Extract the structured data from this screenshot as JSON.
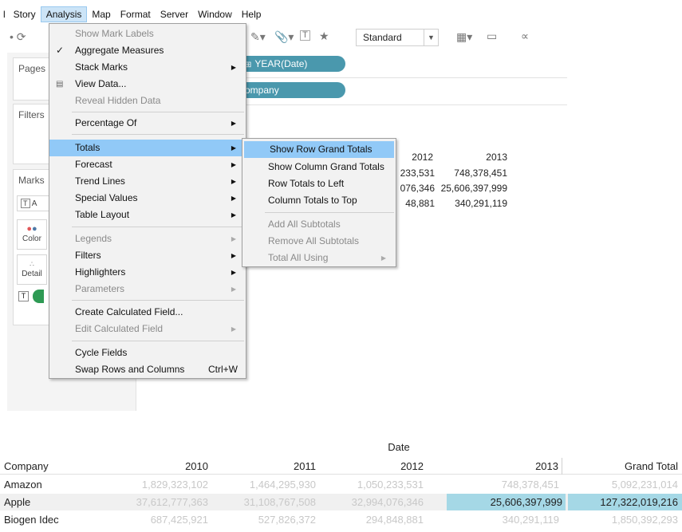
{
  "menubar": {
    "items": [
      "Story",
      "Analysis",
      "Map",
      "Format",
      "Server",
      "Window",
      "Help"
    ],
    "active": "Analysis"
  },
  "toolbar": {
    "standard_label": "Standard"
  },
  "left_panel": {
    "pages_title": "Pages",
    "filters_title": "Filters",
    "marks_title": "Marks",
    "color_label": "Color",
    "detail_label": "Detail",
    "text_chip": "A"
  },
  "shelves": {
    "columns_pill": "YEAR(Date)",
    "rows_pill": "ompany"
  },
  "view_grid": {
    "headers": [
      "2012",
      "2013"
    ],
    "rows": [
      [
        "233,531",
        "748,378,451"
      ],
      [
        "076,346",
        "25,606,397,999"
      ],
      [
        "48,881",
        "340,291,119"
      ]
    ]
  },
  "analysis_menu": {
    "items": [
      {
        "label": "Show Mark Labels",
        "disabled": true
      },
      {
        "label": "Aggregate Measures",
        "checked": true
      },
      {
        "label": "Stack Marks",
        "submenu": true
      },
      {
        "label": "View Data...",
        "icon": "table-icon"
      },
      {
        "label": "Reveal Hidden Data",
        "disabled": true
      },
      {
        "label": "Percentage Of",
        "submenu": true
      },
      {
        "label": "Totals",
        "submenu": true,
        "highlighted": true
      },
      {
        "label": "Forecast",
        "submenu": true
      },
      {
        "label": "Trend Lines",
        "submenu": true
      },
      {
        "label": "Special Values",
        "submenu": true
      },
      {
        "label": "Table Layout",
        "submenu": true
      },
      {
        "label": "Legends",
        "submenu": true,
        "disabled": true
      },
      {
        "label": "Filters",
        "submenu": true
      },
      {
        "label": "Highlighters",
        "submenu": true
      },
      {
        "label": "Parameters",
        "submenu": true,
        "disabled": true
      },
      {
        "label": "Create Calculated Field..."
      },
      {
        "label": "Edit Calculated Field",
        "submenu": true,
        "disabled": true
      },
      {
        "label": "Cycle Fields"
      },
      {
        "label": "Swap Rows and Columns",
        "shortcut": "Ctrl+W"
      }
    ]
  },
  "totals_menu": {
    "items": [
      {
        "label": "Show Row Grand Totals",
        "highlighted": true
      },
      {
        "label": "Show Column Grand Totals"
      },
      {
        "label": "Row Totals to Left"
      },
      {
        "label": "Column Totals to Top"
      },
      {
        "label": "Add All Subtotals",
        "disabled": true
      },
      {
        "label": "Remove All Subtotals",
        "disabled": true
      },
      {
        "label": "Total All Using",
        "disabled": true,
        "submenu": true
      }
    ]
  },
  "result_table": {
    "date_header": "Date",
    "company_header": "Company",
    "columns": [
      "2010",
      "2011",
      "2012",
      "2013",
      "Grand Total"
    ],
    "rows": [
      {
        "company": "Amazon",
        "values": [
          "1,829,323,102",
          "1,464,295,930",
          "1,050,233,531",
          "748,378,451",
          "5,092,231,014"
        ]
      },
      {
        "company": "Apple",
        "values": [
          "37,612,777,363",
          "31,108,767,508",
          "32,994,076,346",
          "25,606,397,999",
          "127,322,019,216"
        ]
      },
      {
        "company": "Biogen Idec",
        "values": [
          "687,425,921",
          "527,826,372",
          "294,848,881",
          "340,291,119",
          "1,850,392,293"
        ]
      }
    ]
  },
  "colors": {
    "highlight_menu": "#91c9f7",
    "pill": "#4a98ad",
    "cell_highlight": "#a5d8e6"
  }
}
